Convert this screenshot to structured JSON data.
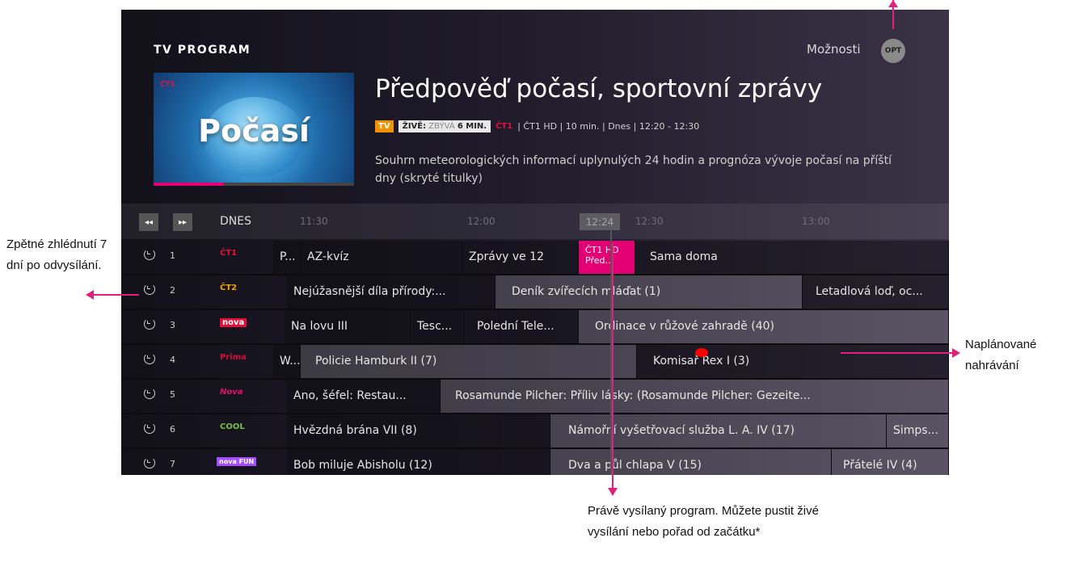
{
  "header": {
    "title": "TV PROGRAM",
    "options_label": "Možnosti",
    "options_button": "OPT"
  },
  "preview": {
    "channel_logo": "ČT1",
    "thumbnail_text": "Počasí",
    "progress": 0.35
  },
  "program": {
    "title": "Předpověď počasí, sportovní zprávy",
    "tag_tv": "TV",
    "live_label": "ŽIVĚ:",
    "remaining_label": "ZBÝVÁ",
    "remaining_value": "6 MIN.",
    "channel_logo": "ČT1",
    "meta": "| ČT1 HD | 10 min. | Dnes | 12:20 - 12:30",
    "description": "Souhrn meteorologických informací uplynulých 24 hodin a prognóza vývoje počasí na příští dny (skryté titulky)"
  },
  "timeline": {
    "rewind_icon": "◂◂",
    "forward_icon": "▸▸",
    "day": "DNES",
    "ticks": [
      "11:30",
      "12:00",
      "12:30",
      "13:00"
    ],
    "now": "12:24"
  },
  "channels": [
    {
      "number": "1",
      "logo": "ČT1",
      "logo_color": "#e2103b",
      "programs": [
        "P...",
        "AZ-kvíz",
        "Zprávy ve 12",
        "Sama doma"
      ],
      "live": {
        "line1": "ČT1 HD",
        "line2": "Před..."
      }
    },
    {
      "number": "2",
      "logo": "ČT2",
      "logo_color": "#f5a300",
      "programs": [
        "Nejúžasnější díla přírody:...",
        "Deník zvířecích mláďat (1)",
        "Letadlová loď, oc..."
      ]
    },
    {
      "number": "3",
      "logo": "nova",
      "logo_color": "#e2103b",
      "programs": [
        "Na lovu III",
        "Tesc...",
        "Polední Tele...",
        "Ordinace v růžové zahradě (40)"
      ]
    },
    {
      "number": "4",
      "logo": "Prima",
      "logo_color": "#d0103b",
      "programs": [
        "W...",
        "Policie Hamburk II (7)",
        "Komisař Rex I (3)"
      ]
    },
    {
      "number": "5",
      "logo": "Nova",
      "logo_color": "#e2106b",
      "programs": [
        "Ano, šéfel: Restau...",
        "Rosamunde Pilcher: Příliv lásky: (Rosamunde Pilcher: Gezeite..."
      ]
    },
    {
      "number": "6",
      "logo": "COOL",
      "logo_color": "#7bc043",
      "programs": [
        "Hvězdná brána VII (8)",
        "Námořní vyšetřovací služba L. A. IV (17)",
        "Simps..."
      ]
    },
    {
      "number": "7",
      "logo": "nova FUN",
      "logo_color": "#a64dff",
      "programs": [
        "Bob miluje Abisholu (12)",
        "Dva a půl chlapa V (15)",
        "Přátelé IV (4)"
      ]
    }
  ],
  "callouts": {
    "catchup": "Zpětné zhlédnutí 7 dní po odvysílání.",
    "recording": "Naplánované nahrávání",
    "live": "Právě vysílaný program. Můžete pustit živé vysílání nebo pořad od začátku*"
  },
  "colors": {
    "accent": "#e20074",
    "tv_tag": "#f39200",
    "record": "#ff0000"
  }
}
